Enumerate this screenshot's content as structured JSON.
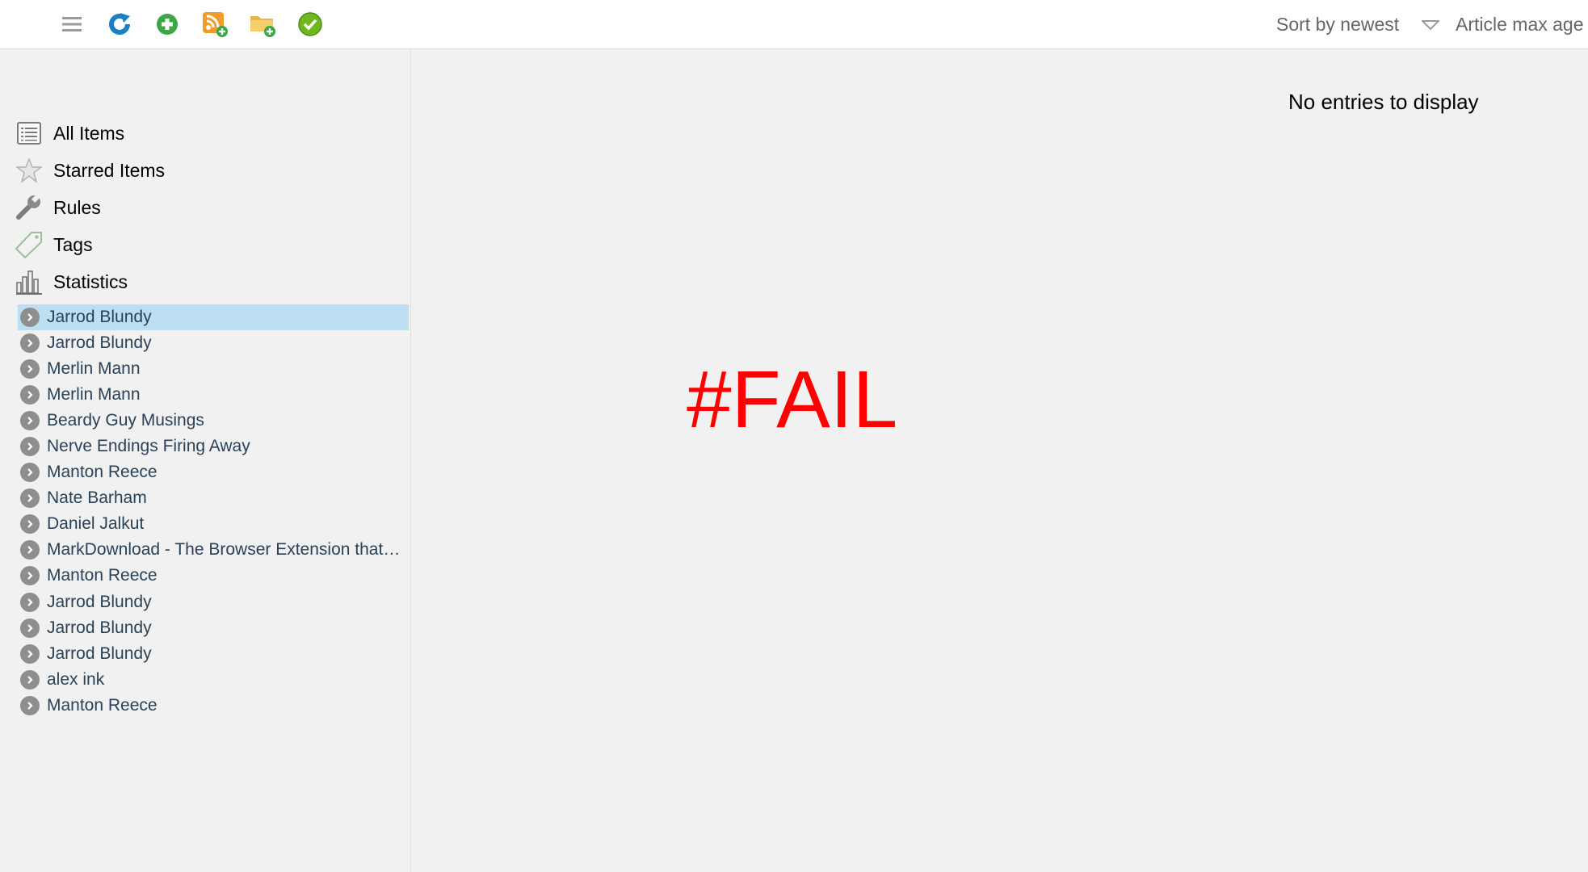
{
  "toolbar": {
    "icons": [
      "menu-icon",
      "refresh-icon",
      "add-icon",
      "add-feed-icon",
      "add-folder-icon",
      "mark-read-icon"
    ],
    "sort_label": "Sort by newest",
    "age_label": "Article max age"
  },
  "sidebar": {
    "nav": [
      {
        "label": "All Items",
        "icon": "list-icon"
      },
      {
        "label": "Starred Items",
        "icon": "star-icon"
      },
      {
        "label": "Rules",
        "icon": "wrench-icon"
      },
      {
        "label": "Tags",
        "icon": "tag-icon"
      },
      {
        "label": "Statistics",
        "icon": "bar-chart-icon"
      }
    ],
    "feeds": [
      "Jarrod Blundy",
      "Jarrod Blundy",
      "Merlin Mann",
      "Merlin Mann",
      "Beardy Guy Musings",
      "Nerve Endings Firing Away",
      "Manton Reece",
      "Nate Barham",
      "Daniel Jalkut",
      "MarkDownload - The Browser Extension that lets you download web pages as markdown",
      "Manton Reece",
      "Jarrod Blundy",
      "Jarrod Blundy",
      "Jarrod Blundy",
      "alex ink",
      "Manton Reece"
    ]
  },
  "main": {
    "empty_message": "No entries to display",
    "overlay_text": "#FAIL"
  },
  "colors": {
    "selected_bg": "#bcdff1",
    "feed_text": "#2a4158",
    "overlay": "#ff0000"
  }
}
